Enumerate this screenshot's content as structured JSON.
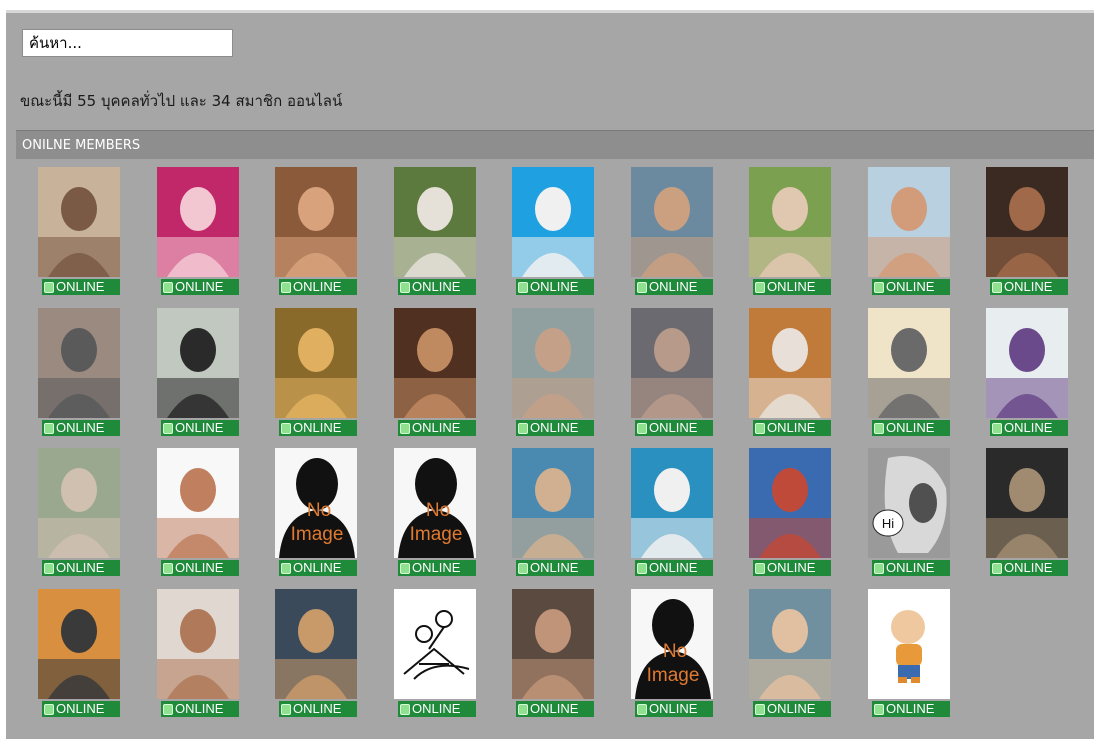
{
  "search": {
    "placeholder": "ค้นหา..."
  },
  "status_text": "ขณะนี้มี 55 บุคคลทั่วไป และ 34 สมาชิก ออนไลน์",
  "section_title": "ONILNE MEMBERS",
  "no_image_label": [
    "No",
    "Image"
  ],
  "hi_label": "Hi",
  "online_label": "ONLINE",
  "colors": {
    "panel": "#a6a6a6",
    "header": "#8e8e8e",
    "badge": "#1f8a3a"
  },
  "members": [
    {
      "kind": "photo",
      "bg": "#c9b29a",
      "fg": "#7a5a44"
    },
    {
      "kind": "photo",
      "bg": "#c0286a",
      "fg": "#f3c7d2"
    },
    {
      "kind": "photo",
      "bg": "#8a5a3a",
      "fg": "#d8a27c"
    },
    {
      "kind": "photo",
      "bg": "#5d7a3e",
      "fg": "#e5e0d8"
    },
    {
      "kind": "photo",
      "bg": "#1fa0e0",
      "fg": "#f0f0f0"
    },
    {
      "kind": "photo",
      "bg": "#6b8aa0",
      "fg": "#caa081"
    },
    {
      "kind": "photo",
      "bg": "#7aa050",
      "fg": "#e0c8b0"
    },
    {
      "kind": "photo",
      "bg": "#b8d0e0",
      "fg": "#d29c7a"
    },
    {
      "kind": "photo",
      "bg": "#3a2a22",
      "fg": "#a06a4a"
    },
    {
      "kind": "photo",
      "bg": "#9a8a80",
      "fg": "#5a5a5a"
    },
    {
      "kind": "photo",
      "bg": "#c0c8c0",
      "fg": "#2a2a2a"
    },
    {
      "kind": "photo",
      "bg": "#8a6a2a",
      "fg": "#e0b060"
    },
    {
      "kind": "photo",
      "bg": "#503020",
      "fg": "#c08a60"
    },
    {
      "kind": "photo",
      "bg": "#90a0a0",
      "fg": "#c4a088"
    },
    {
      "kind": "photo",
      "bg": "#6a6a70",
      "fg": "#b89a8a"
    },
    {
      "kind": "photo",
      "bg": "#c07a3a",
      "fg": "#e8e0d8"
    },
    {
      "kind": "photo",
      "bg": "#f0e4c8",
      "fg": "#6a6a6a"
    },
    {
      "kind": "photo",
      "bg": "#e8eef0",
      "fg": "#6a4a8a"
    },
    {
      "kind": "photo",
      "bg": "#9aa890",
      "fg": "#d0c0b0"
    },
    {
      "kind": "photo",
      "bg": "#f8f8f8",
      "fg": "#c08060"
    },
    {
      "kind": "noimage"
    },
    {
      "kind": "noimage"
    },
    {
      "kind": "photo",
      "bg": "#4a8ab0",
      "fg": "#d0b090"
    },
    {
      "kind": "photo",
      "bg": "#2a90c0",
      "fg": "#f0f0f0"
    },
    {
      "kind": "photo",
      "bg": "#3a6ab0",
      "fg": "#c04a3a"
    },
    {
      "kind": "hi"
    },
    {
      "kind": "photo",
      "bg": "#2a2a2a",
      "fg": "#a08a70"
    },
    {
      "kind": "photo",
      "bg": "#d89040",
      "fg": "#3a3a3a"
    },
    {
      "kind": "photo",
      "bg": "#e0d8d0",
      "fg": "#b07a5a"
    },
    {
      "kind": "photo",
      "bg": "#3a4a5a",
      "fg": "#c89a6a"
    },
    {
      "kind": "sketch"
    },
    {
      "kind": "photo",
      "bg": "#5a4a40",
      "fg": "#c09478"
    },
    {
      "kind": "noimage"
    },
    {
      "kind": "photo",
      "bg": "#7090a0",
      "fg": "#e0c0a0"
    },
    {
      "kind": "cartoon"
    }
  ]
}
